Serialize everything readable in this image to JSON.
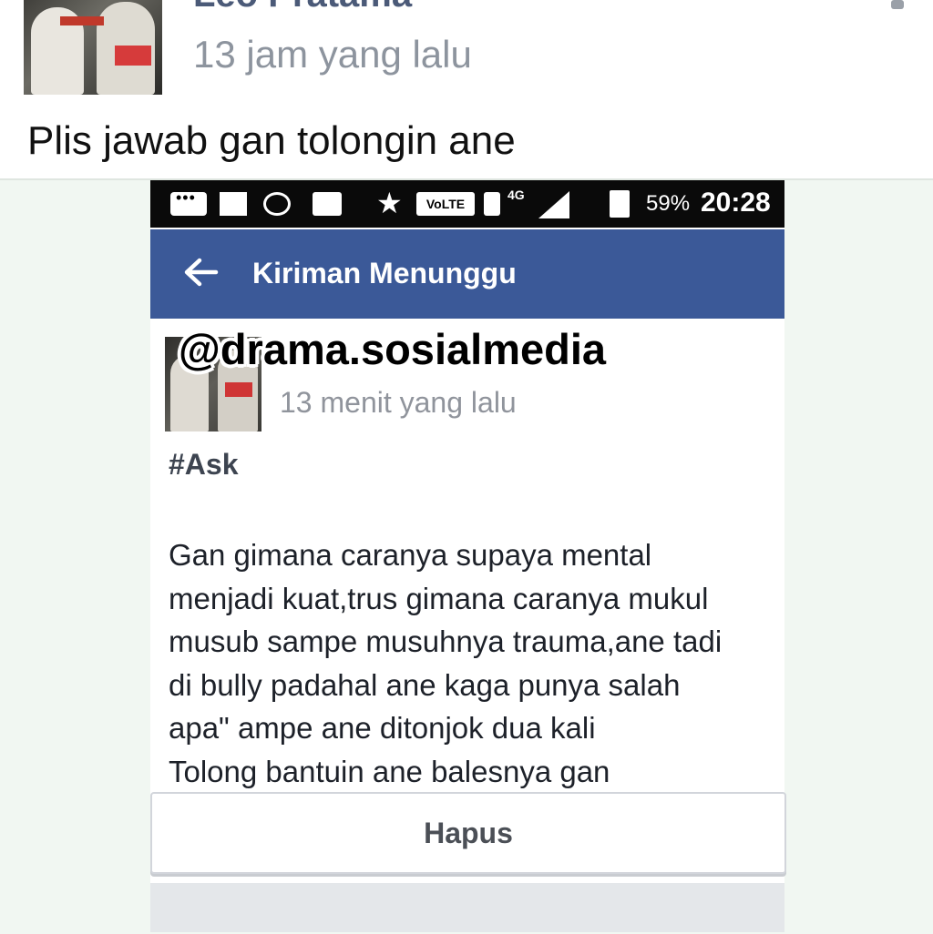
{
  "outer_post": {
    "author_name": "Leo Pratama",
    "timestamp": "13 jam yang lalu",
    "text": "Plis jawab gan tolongin ane"
  },
  "status_bar": {
    "volte": "VoLTE",
    "network": "4G",
    "battery": "59%",
    "time": "20:28"
  },
  "app_bar": {
    "title": "Kiriman Menunggu"
  },
  "watermark": "@drama.sosialmedia",
  "inner_post": {
    "timestamp": "13 menit yang lalu",
    "hashtag": "#Ask",
    "lines": [
      "Gan gimana caranya supaya mental",
      "menjadi kuat,trus gimana caranya mukul",
      "musub sampe musuhnya trauma,ane tadi",
      "di bully padahal ane kaga punya salah",
      "apa\" ampe ane ditonjok dua kali",
      "Tolong bantuin ane balesnya gan"
    ]
  },
  "actions": {
    "delete_label": "Hapus"
  },
  "colors": {
    "facebook_blue": "#3b5998",
    "status_bar": "#0a0a0a",
    "frame_bg": "#f1f7f2"
  }
}
